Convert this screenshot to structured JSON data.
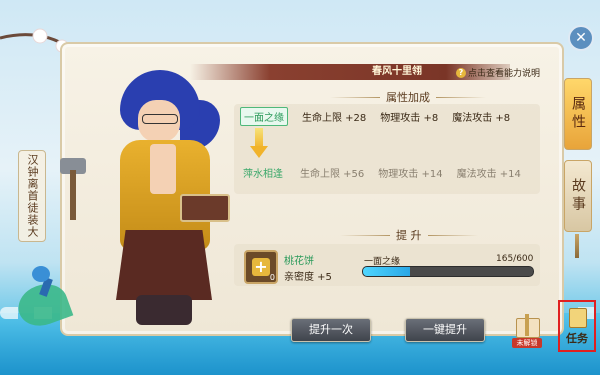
{
  "character": {
    "side_title": "汉钟离首徒装大",
    "banner_name": "春风十里翎",
    "ability_link": "点击查看能力说明"
  },
  "attributes": {
    "title": "属性加成",
    "current": {
      "tag": "一面之缘",
      "stats": [
        "生命上限 +28",
        "物理攻击 +8",
        "魔法攻击 +8"
      ]
    },
    "next": {
      "tag": "萍水相逢",
      "stats": [
        "生命上限 +56",
        "物理攻击 +14",
        "魔法攻击 +14"
      ]
    }
  },
  "upgrade": {
    "title": "提 升",
    "item_name": "桃花饼",
    "item_count": "0",
    "intimacy": "亲密度 +5",
    "bond_level": "一面之缘",
    "progress_text": "165/600",
    "progress": 0.275
  },
  "buttons": {
    "upgrade_once": "提升一次",
    "upgrade_all": "一键提升"
  },
  "tabs": {
    "attributes": "属性",
    "story": "故事"
  },
  "close_glyph": "✕",
  "gift_label": "未解锁",
  "task_label": "任务",
  "colors": {
    "accent_gold": "#e8a43a",
    "progress": "#2aa7e6",
    "highlight_red": "#e02020",
    "tag_green": "#2a9a5a"
  }
}
